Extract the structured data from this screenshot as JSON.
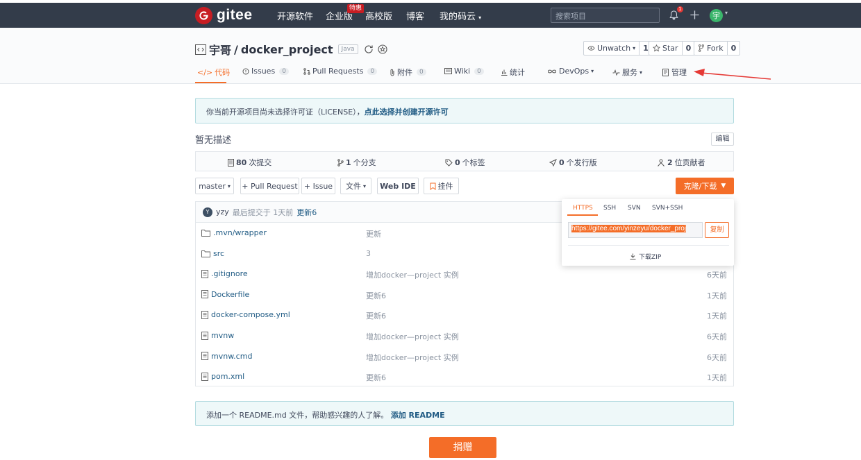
{
  "topnav": {
    "logo_text": "gitee",
    "links": [
      "开源软件",
      "企业版",
      "高校版",
      "博客",
      "我的码云"
    ],
    "enterprise_badge": "特惠",
    "search_placeholder": "搜索项目",
    "notif_count": "1",
    "avatar_letter": "宇"
  },
  "repo": {
    "owner": "宇哥",
    "separator": "/",
    "name": "docker_project",
    "lang_tag": "Java",
    "watch": {
      "label": "Unwatch",
      "count": "1"
    },
    "star": {
      "label": "Star",
      "count": "0"
    },
    "fork": {
      "label": "Fork",
      "count": "0"
    }
  },
  "tabs": [
    {
      "label": "代码"
    },
    {
      "label": "Issues",
      "count": "0"
    },
    {
      "label": "Pull Requests",
      "count": "0"
    },
    {
      "label": "附件",
      "count": "0"
    },
    {
      "label": "Wiki",
      "count": "0"
    },
    {
      "label": "统计"
    },
    {
      "label": "DevOps"
    },
    {
      "label": "服务"
    },
    {
      "label": "管理"
    }
  ],
  "license_notice": {
    "text": "你当前开源项目尚未选择许可证（LICENSE），",
    "link": "点此选择并创建开源许可"
  },
  "description": "暂无描述",
  "edit_label": "编辑",
  "stats": [
    {
      "num": "80",
      "label": "次提交"
    },
    {
      "num": "1",
      "label": "个分支"
    },
    {
      "num": "0",
      "label": "个标签"
    },
    {
      "num": "0",
      "label": "个发行版"
    },
    {
      "num": "2",
      "label": "位贡献者"
    }
  ],
  "toolbar": {
    "branch": "master",
    "pull_request": "+ Pull Request",
    "issue": "+ Issue",
    "file": "文件",
    "webide": "Web IDE",
    "bookmark": "挂件",
    "clone": "克隆/下载"
  },
  "commit": {
    "avatar": "Y",
    "author": "yzy",
    "text": "最后提交于 1天前",
    "message": "更新6"
  },
  "files": [
    {
      "name": ".mvn/wrapper",
      "type": "folder",
      "msg": "更新",
      "time": ""
    },
    {
      "name": "src",
      "type": "folder",
      "msg": "3",
      "time": ""
    },
    {
      "name": ".gitignore",
      "type": "file",
      "msg": "增加docker—project 实例",
      "time": "6天前"
    },
    {
      "name": "Dockerfile",
      "type": "file",
      "msg": "更新6",
      "time": "1天前"
    },
    {
      "name": "docker-compose.yml",
      "type": "file",
      "msg": "更新6",
      "time": "1天前"
    },
    {
      "name": "mvnw",
      "type": "file",
      "msg": "增加docker—project 实例",
      "time": "6天前"
    },
    {
      "name": "mvnw.cmd",
      "type": "file",
      "msg": "增加docker—project 实例",
      "time": "6天前"
    },
    {
      "name": "pom.xml",
      "type": "file",
      "msg": "更新6",
      "time": "1天前"
    }
  ],
  "clone_popup": {
    "tabs": [
      "HTTPS",
      "SSH",
      "SVN",
      "SVN+SSH"
    ],
    "url": "https://gitee.com/yinzeyu/docker_proj",
    "copy": "复制",
    "download_zip": "下载ZIP"
  },
  "readme_notice": {
    "text": "添加一个 README.md 文件，帮助感兴趣的人了解。",
    "link": "添加 README"
  },
  "donate": "捐赠",
  "colors": {
    "accent": "#f46d28",
    "nav_bg": "#333c4a",
    "brand_red": "#c71d23",
    "link": "#205b84"
  }
}
